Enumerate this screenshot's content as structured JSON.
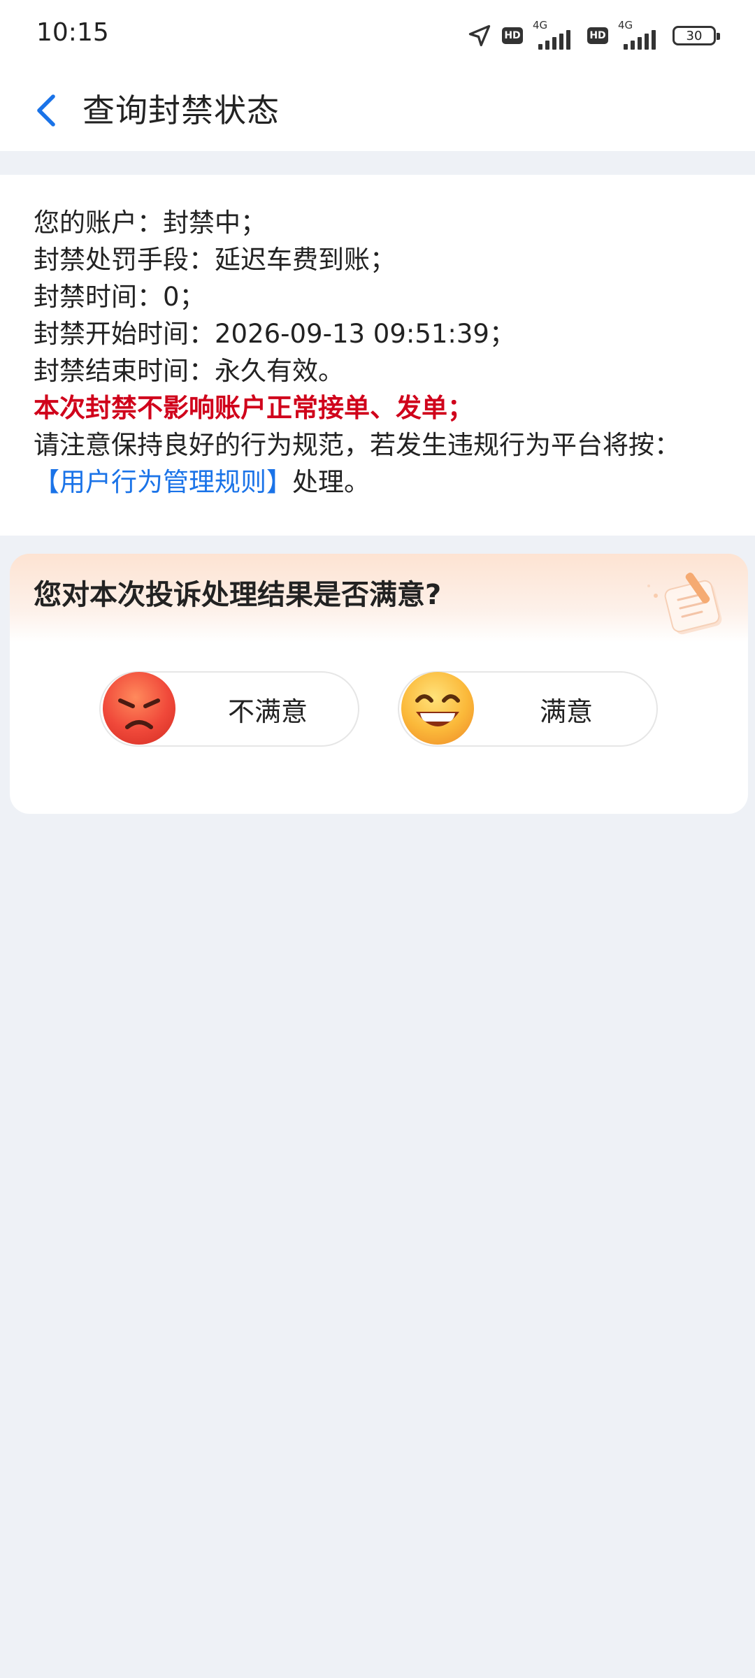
{
  "status_bar": {
    "time": "10:15",
    "hd_label": "HD",
    "net_label": "4G",
    "battery": "30"
  },
  "header": {
    "title": "查询封禁状态"
  },
  "info": {
    "account": "您的账户：封禁中；",
    "penalty": "封禁处罚手段：延迟车费到账；",
    "duration": "封禁时间：0；",
    "start_time": "封禁开始时间：2026-09-13 09:51:39；",
    "end_time": "封禁结束时间：永久有效。",
    "notice": "本次封禁不影响账户正常接单、发单；",
    "advice": "请注意保持良好的行为规范，若发生违规行为平台将按：",
    "rule_link": "【用户行为管理规则】",
    "rule_suffix": "处理。"
  },
  "survey": {
    "question": "您对本次投诉处理结果是否满意?",
    "dissatisfied_label": "不满意",
    "satisfied_label": "满意"
  },
  "colors": {
    "accent_blue": "#1a73e8",
    "warning_red": "#d0021b",
    "page_bg": "#eef1f6"
  },
  "icons": {
    "back": "chevron-left-icon",
    "location": "location-arrow-icon",
    "dissatisfied": "angry-face-icon",
    "satisfied": "grinning-face-icon",
    "decoration": "note-pencil-icon"
  }
}
